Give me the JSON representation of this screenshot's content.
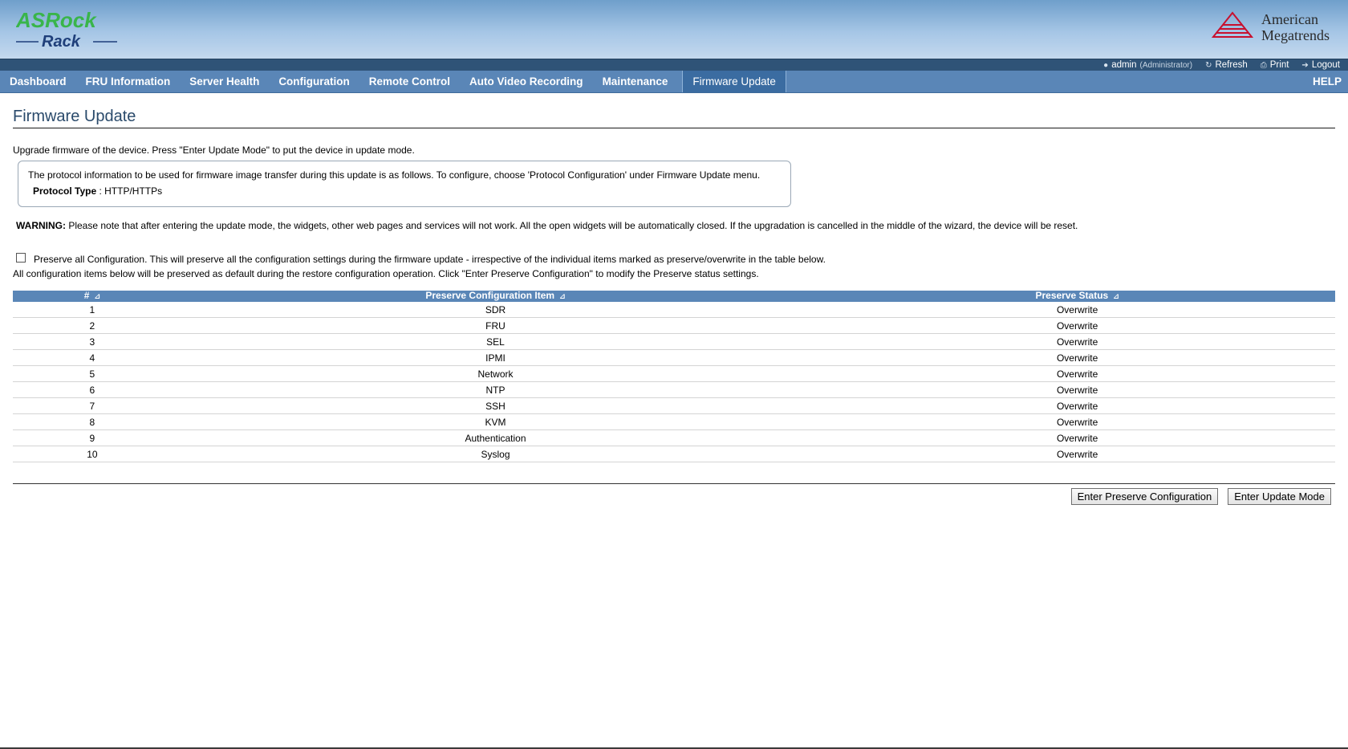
{
  "brand": {
    "left_logo_line1": "ASRock",
    "left_logo_line2": "Rack",
    "right_logo_line1": "American",
    "right_logo_line2": "Megatrends",
    "left_logo_color": "#39b54a",
    "right_logo_color": "#c8102e"
  },
  "utility": {
    "user": "admin",
    "role": "(Administrator)",
    "refresh": "Refresh",
    "print": "Print",
    "logout": "Logout"
  },
  "nav": {
    "items": [
      {
        "label": "Dashboard"
      },
      {
        "label": "FRU Information"
      },
      {
        "label": "Server Health"
      },
      {
        "label": "Configuration"
      },
      {
        "label": "Remote Control"
      },
      {
        "label": "Auto Video Recording"
      },
      {
        "label": "Maintenance"
      },
      {
        "label": "Firmware Update"
      }
    ],
    "active": "Firmware Update",
    "help": "HELP"
  },
  "page": {
    "title": "Firmware Update",
    "intro": "Upgrade firmware of the device. Press \"Enter Update Mode\" to put the device in update mode.",
    "protocol_info": "The protocol information to be used for firmware image transfer during this update is as follows. To configure, choose 'Protocol Configuration' under Firmware Update menu.",
    "protocol_label": "Protocol Type",
    "protocol_value": ": HTTP/HTTPs",
    "warning_label": "WARNING:",
    "warning_text": " Please note that after entering the update mode, the widgets, other web pages and services will not work. All the open widgets will be automatically closed. If the upgradation is cancelled in the middle of the wizard, the device will be reset.",
    "preserve_all_label": "Preserve all Configuration. This will preserve all the configuration settings during the firmware update - irrespective of the individual items marked as preserve/overwrite in the table below.",
    "preserve_all_checked": false,
    "default_note": "All configuration items below will be preserved as default during the restore configuration operation. Click \"Enter Preserve Configuration\" to modify the Preserve status settings."
  },
  "table": {
    "headers": [
      "#",
      "Preserve Configuration Item",
      "Preserve Status"
    ],
    "rows": [
      {
        "num": "1",
        "item": "SDR",
        "status": "Overwrite"
      },
      {
        "num": "2",
        "item": "FRU",
        "status": "Overwrite"
      },
      {
        "num": "3",
        "item": "SEL",
        "status": "Overwrite"
      },
      {
        "num": "4",
        "item": "IPMI",
        "status": "Overwrite"
      },
      {
        "num": "5",
        "item": "Network",
        "status": "Overwrite"
      },
      {
        "num": "6",
        "item": "NTP",
        "status": "Overwrite"
      },
      {
        "num": "7",
        "item": "SSH",
        "status": "Overwrite"
      },
      {
        "num": "8",
        "item": "KVM",
        "status": "Overwrite"
      },
      {
        "num": "9",
        "item": "Authentication",
        "status": "Overwrite"
      },
      {
        "num": "10",
        "item": "Syslog",
        "status": "Overwrite"
      }
    ]
  },
  "buttons": {
    "preserve_config": "Enter Preserve Configuration",
    "update_mode": "Enter Update Mode"
  },
  "colors": {
    "nav_bg": "#5a86b7",
    "nav_active_bg": "#3b6ca1",
    "utility_bg": "#2f5377",
    "title_color": "#2a4a6b"
  }
}
